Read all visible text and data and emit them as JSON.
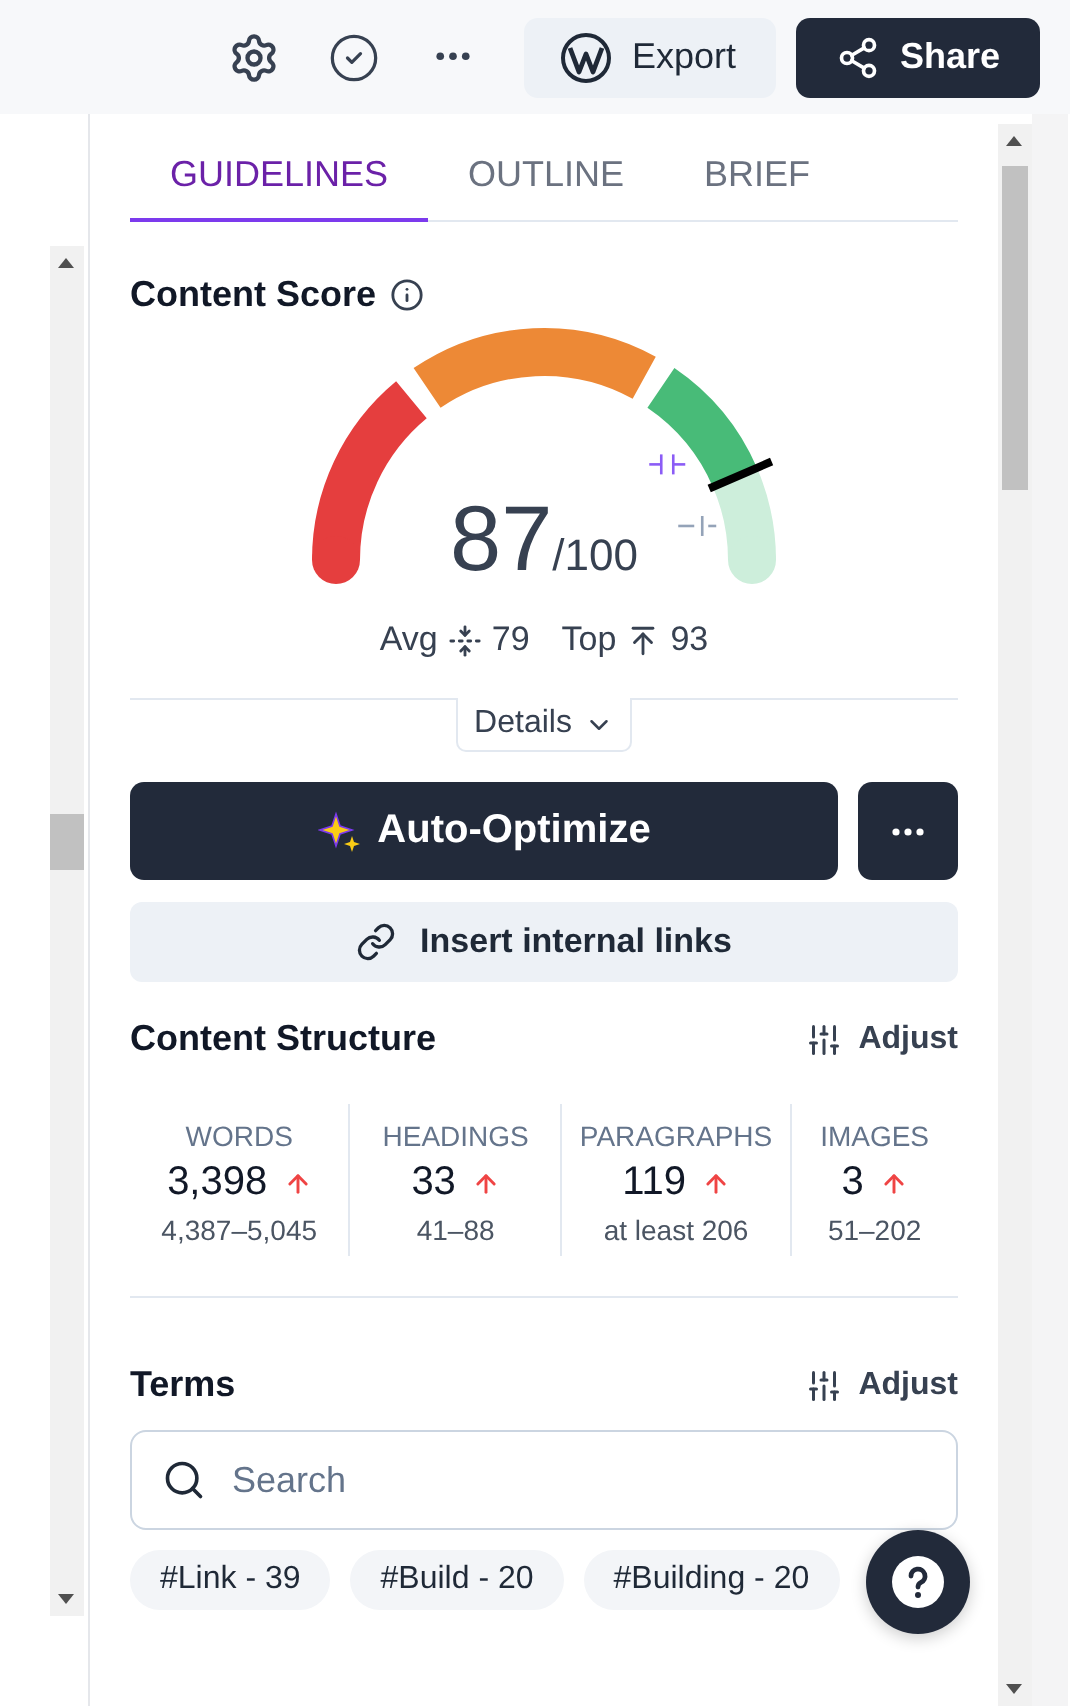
{
  "toolbar": {
    "buttons": [
      {
        "label": "Export",
        "kind": "secondary"
      },
      {
        "label": "Share",
        "kind": "primary"
      }
    ]
  },
  "tabs": [
    {
      "label": "GUIDELINES",
      "selected": true
    },
    {
      "label": "OUTLINE",
      "selected": false
    },
    {
      "label": "BRIEF",
      "selected": false
    }
  ],
  "content_score": {
    "title": "Content Score",
    "score": "87",
    "max": "/100",
    "avg": {
      "label": "Avg",
      "value": "79"
    },
    "top": {
      "label": "Top",
      "value": "93"
    },
    "details": "Details"
  },
  "actions": {
    "optimize": "Auto-Optimize",
    "links": "Insert internal links"
  },
  "structure": {
    "title": "Content Structure",
    "adjust": "Adjust",
    "metrics": [
      {
        "label": "WORDS",
        "value": "3,398",
        "target": "4,387–5,045"
      },
      {
        "label": "HEADINGS",
        "value": "33",
        "target": "41–88"
      },
      {
        "label": "PARAGRAPHS",
        "value": "119",
        "target": "at least 206"
      },
      {
        "label": "IMAGES",
        "value": "3",
        "target": "51–202"
      }
    ]
  },
  "terms": {
    "title": "Terms",
    "adjust": "Adjust",
    "search": {
      "placeholder": "Search"
    },
    "tags": [
      "#Link - 39",
      "#Build - 20",
      "#Building - 20"
    ]
  }
}
